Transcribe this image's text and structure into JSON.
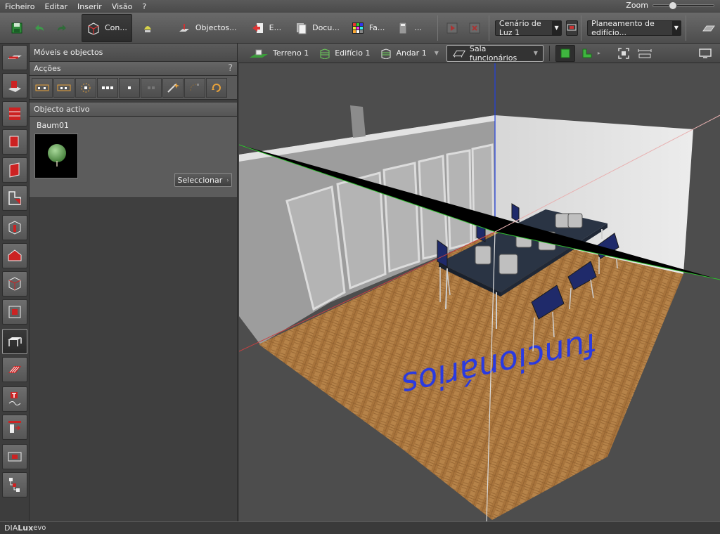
{
  "menu": {
    "items": [
      "Ficheiro",
      "Editar",
      "Inserir",
      "Visão",
      "?"
    ],
    "zoom_label": "Zoom",
    "zoom_level": 0.3
  },
  "toolbar": {
    "construction_label": "Con...",
    "objects_label": "Objectos...",
    "export_label": "E...",
    "documentation_label": "Docu...",
    "facades_label": "Fa...",
    "more_label": "...",
    "light_scene_value": "Cenário de Luz 1",
    "planning_value": "Planeamento de edifício..."
  },
  "panel": {
    "title": "Móveis e objectos",
    "actions_title": "Acções",
    "help_label": "?",
    "active_title": "Objecto activo",
    "active_name": "Baum01",
    "select_label": "Seleccionar"
  },
  "viewport_tabs": {
    "terrain": "Terreno 1",
    "building": "Edifício 1",
    "floor": "Andar 1",
    "room": "Sala funcionários"
  },
  "scene": {
    "floor_text": "funcionários"
  },
  "statusbar": {
    "brand_prefix": "DIA",
    "brand_mid": "Lux",
    "brand_suffix": " evo"
  }
}
